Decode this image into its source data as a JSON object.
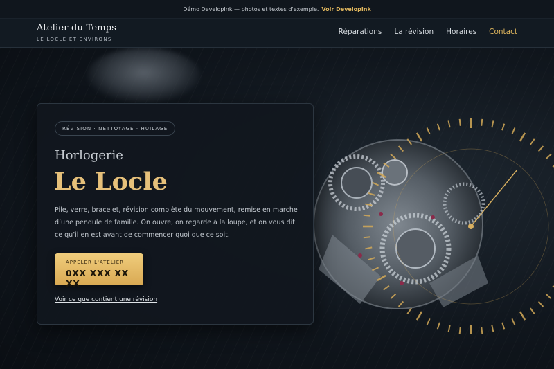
{
  "demo_banner": {
    "text": "Démo DevelopInk — photos et textes d'exemple.",
    "link_label": "Voir DevelopInk"
  },
  "header": {
    "brand_name": "Atelier du Temps",
    "brand_tagline": "LE LOCLE ET ENVIRONS",
    "nav": [
      {
        "label": "Réparations"
      },
      {
        "label": "La révision"
      },
      {
        "label": "Horaires"
      },
      {
        "label": "Contact"
      }
    ]
  },
  "hero": {
    "chip": "RÉVISION · NETTOYAGE · HUILAGE",
    "eyebrow": "Horlogerie",
    "title": "Le Locle",
    "description": "Pile, verre, bracelet, révision complète du mouvement, remise en marche d’une pendule de famille. On ouvre, on regarde à la loupe, et on vous dit ce qu’il en est avant de commencer quoi que ce soit.",
    "cta": {
      "label": "APPELER L'ATELIER",
      "phone": "0XX XXX XX XX"
    },
    "secondary_link": "Voir ce que contient une révision"
  },
  "colors": {
    "accent": "#e2b85e",
    "title_gold": "#e6c07a",
    "background": "#0b1016",
    "card": "#11171e"
  }
}
